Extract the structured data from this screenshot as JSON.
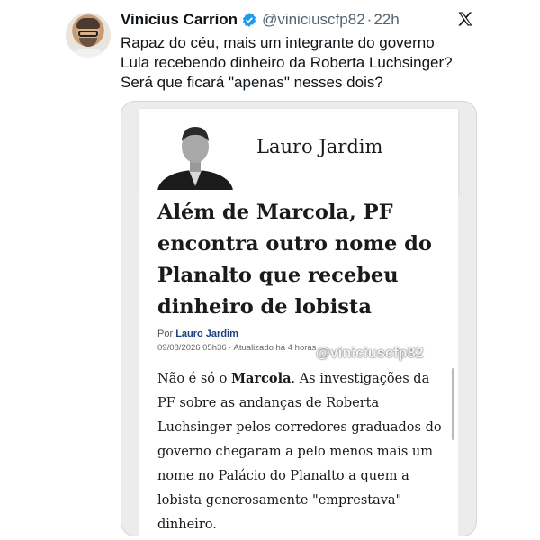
{
  "tweet": {
    "author_name": "Vinicius Carrion",
    "handle": "@viniciuscfp82",
    "separator": "·",
    "time": "22h",
    "text": "Rapaz do céu, mais um integrante do governo\nLula recebendo dinheiro da Roberta Luchsinger?\nSerá que ficará \"apenas\" nesses dois?",
    "icons": {
      "verified": "verified-badge-icon",
      "platform": "x-logo-icon"
    },
    "colors": {
      "verified": "#1d9bf0",
      "secondary_text": "#536471"
    }
  },
  "article": {
    "columnist": "Lauro Jardim",
    "headline": "Além de Marcola, PF encontra outro nome do Planalto que recebeu dinheiro de lobista",
    "byline_prefix": "Por",
    "byline_author": "Lauro Jardim",
    "meta": "09/08/2026 05h36 · Atualizado há 4 horas",
    "body_before": "Não é só o ",
    "body_bold": "Marcola",
    "body_after": ". As investigações da PF sobre as andanças de Roberta Luchsinger pelos corredores graduados do governo chegaram a pelo menos mais um nome no Palácio do Planalto a quem a lobista generosamente \"emprestava\" dinheiro.",
    "watermark": "@viniciuscfp82"
  }
}
